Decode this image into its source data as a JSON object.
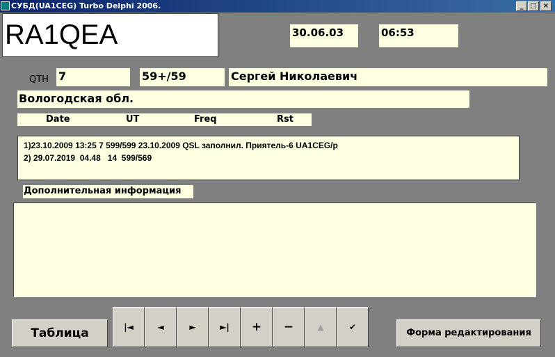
{
  "window": {
    "title": "СУБД(UA1CEG) Turbo Delphi 2006.",
    "min_label": "_",
    "max_label": "□",
    "close_label": "×"
  },
  "record": {
    "callsign": "RA1QEA",
    "date": "30.06.03",
    "time": "06:53",
    "qth_label": "QTH",
    "qth": "7",
    "rst": "59+/59",
    "name": "Сергей Николаевич",
    "region": "Вологодская обл."
  },
  "log_headers": [
    "Date",
    "UT",
    "Freq",
    "Rst"
  ],
  "log_lines": [
    "1)23.10.2009 13:25 7 599/599 23.10.2009 QSL заполнил. Приятель-6 UA1CEG/p",
    "2) 29.07.2019  04.48   14  599/569"
  ],
  "extra": {
    "label": "Дополнительная информация",
    "value": ""
  },
  "buttons": {
    "table": "Таблица",
    "edit_form": "Форма редактирования",
    "nav": [
      {
        "name": "nav-first-button",
        "icon": "first-icon",
        "glyph": "|◄",
        "enabled": true
      },
      {
        "name": "nav-prior-button",
        "icon": "prior-icon",
        "glyph": "◄",
        "enabled": true
      },
      {
        "name": "nav-next-button",
        "icon": "next-icon",
        "glyph": "►",
        "enabled": true
      },
      {
        "name": "nav-last-button",
        "icon": "last-icon",
        "glyph": "►|",
        "enabled": true
      },
      {
        "name": "nav-insert-button",
        "icon": "plus-icon",
        "glyph": "+",
        "enabled": true
      },
      {
        "name": "nav-delete-button",
        "icon": "minus-icon",
        "glyph": "−",
        "enabled": true
      },
      {
        "name": "nav-edit-button",
        "icon": "triangle-up-icon",
        "glyph": "▲",
        "enabled": false
      },
      {
        "name": "nav-post-button",
        "icon": "check-icon",
        "glyph": "✔",
        "enabled": true
      }
    ]
  },
  "colors": {
    "form_bg": "#808080",
    "field_bg": "#ffffe1",
    "titlebar": "#0a246a"
  }
}
